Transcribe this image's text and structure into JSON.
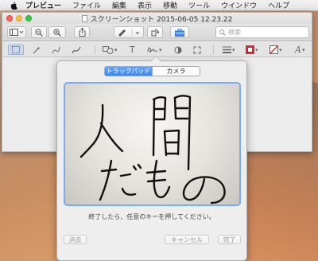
{
  "menubar": {
    "app_name": "プレビュー",
    "items": [
      "ファイル",
      "編集",
      "表示",
      "移動",
      "ツール",
      "ウインドウ",
      "ヘルプ"
    ]
  },
  "window": {
    "title": "スクリーンショット 2015-06-05 12.23.22",
    "search_placeholder": "検索"
  },
  "signature": {
    "tabs": [
      "トラックパッド",
      "カメラ"
    ],
    "active_tab": "トラックパッド",
    "handwritten_text": "人間だもの",
    "instruction": "終了したら、任意のキーを押してください。",
    "buttons": {
      "clear": "消去",
      "cancel": "キャンセル",
      "done": "完了"
    }
  },
  "colors": {
    "accent": "#3a86f0",
    "trackpad_border": "#7aaaf2"
  }
}
